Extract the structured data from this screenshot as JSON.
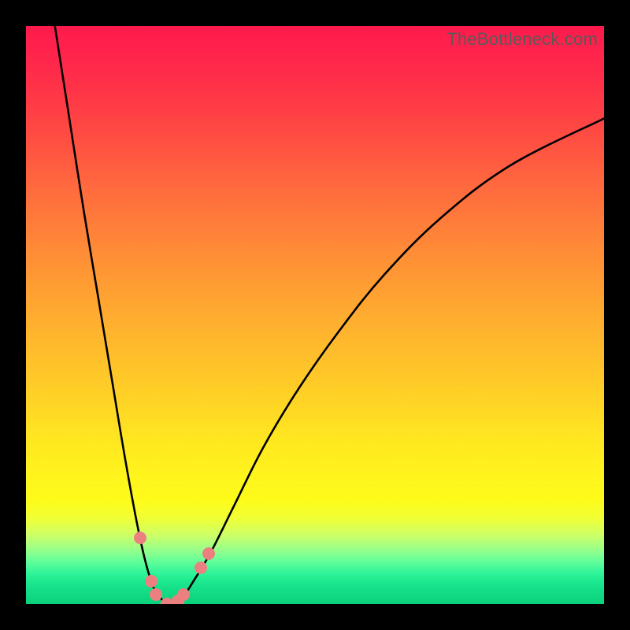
{
  "watermark": "TheBottleneck.com",
  "colors": {
    "frame": "#000000",
    "curve": "#000000",
    "dot": "#ec8080",
    "gradient_top": "#ff1a4d",
    "gradient_bottom": "#0bd07c"
  },
  "chart_data": {
    "type": "line",
    "title": "",
    "xlabel": "",
    "ylabel": "",
    "xlim": [
      0,
      100
    ],
    "ylim": [
      0,
      100
    ],
    "notes": "Two-branch bottleneck curve. y=0 (bottom) is ideal match (green); y=100 (top) is severe bottleneck (red). Valley floor around x≈23–27.",
    "series": [
      {
        "name": "left-branch",
        "x": [
          5.0,
          7.5,
          10.0,
          12.5,
          15.0,
          17.0,
          19.0,
          20.5,
          22.0,
          23.3,
          24.5
        ],
        "values": [
          100,
          84,
          68,
          53,
          38,
          26,
          15,
          8,
          3,
          1,
          0
        ]
      },
      {
        "name": "right-branch",
        "x": [
          25.5,
          27.0,
          29.0,
          32.0,
          36.0,
          41.0,
          47.0,
          54.0,
          62.0,
          72.0,
          84.0,
          100.0
        ],
        "values": [
          0,
          1,
          4,
          9,
          17,
          27,
          37,
          47,
          57,
          67,
          76,
          84
        ]
      }
    ],
    "points": [
      {
        "name": "p1",
        "x": 19.8,
        "y": 11.5
      },
      {
        "name": "p2",
        "x": 21.6,
        "y": 4.0
      },
      {
        "name": "p3",
        "x": 22.5,
        "y": 1.6
      },
      {
        "name": "p4",
        "x": 24.4,
        "y": 0.0
      },
      {
        "name": "p5",
        "x": 26.3,
        "y": 0.5
      },
      {
        "name": "p6",
        "x": 27.3,
        "y": 1.6
      },
      {
        "name": "p7",
        "x": 30.3,
        "y": 6.3
      },
      {
        "name": "p8",
        "x": 31.6,
        "y": 8.7
      }
    ]
  }
}
